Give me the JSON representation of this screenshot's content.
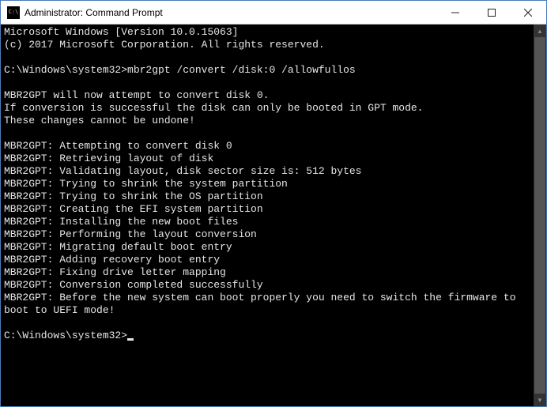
{
  "window": {
    "title": "Administrator: Command Prompt",
    "icon_label": "C:\\"
  },
  "console": {
    "header_line1": "Microsoft Windows [Version 10.0.15063]",
    "header_line2": "(c) 2017 Microsoft Corporation. All rights reserved.",
    "prompt1": "C:\\Windows\\system32>",
    "command1": "mbr2gpt /convert /disk:0 /allowfullos",
    "block1_line1": "MBR2GPT will now attempt to convert disk 0.",
    "block1_line2": "If conversion is successful the disk can only be booted in GPT mode.",
    "block1_line3": "These changes cannot be undone!",
    "log": [
      "MBR2GPT: Attempting to convert disk 0",
      "MBR2GPT: Retrieving layout of disk",
      "MBR2GPT: Validating layout, disk sector size is: 512 bytes",
      "MBR2GPT: Trying to shrink the system partition",
      "MBR2GPT: Trying to shrink the OS partition",
      "MBR2GPT: Creating the EFI system partition",
      "MBR2GPT: Installing the new boot files",
      "MBR2GPT: Performing the layout conversion",
      "MBR2GPT: Migrating default boot entry",
      "MBR2GPT: Adding recovery boot entry",
      "MBR2GPT: Fixing drive letter mapping",
      "MBR2GPT: Conversion completed successfully",
      "MBR2GPT: Before the new system can boot properly you need to switch the firmware to boot to UEFI mode!"
    ],
    "prompt2": "C:\\Windows\\system32>"
  }
}
